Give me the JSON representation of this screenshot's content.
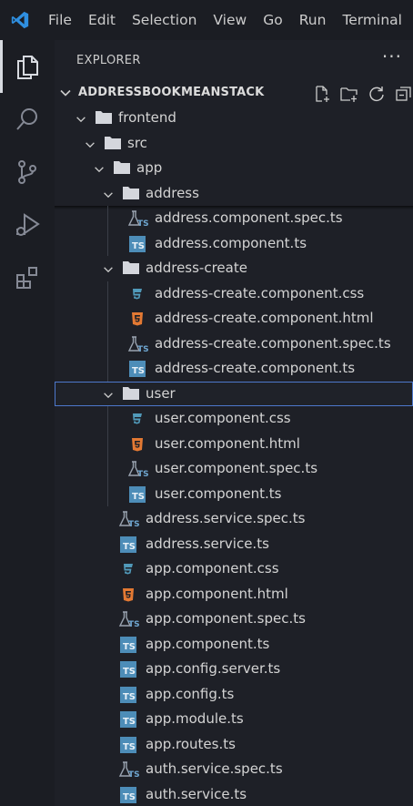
{
  "menu": [
    "File",
    "Edit",
    "Selection",
    "View",
    "Go",
    "Run",
    "Terminal"
  ],
  "activity_bar": [
    {
      "name": "explorer-icon",
      "active": true
    },
    {
      "name": "search-icon",
      "active": false
    },
    {
      "name": "source-control-icon",
      "active": false
    },
    {
      "name": "run-debug-icon",
      "active": false
    },
    {
      "name": "extensions-icon",
      "active": false
    }
  ],
  "explorer": {
    "title": "EXPLORER",
    "more": "···",
    "section_title": "ADDRESSBOOKMEANSTACK",
    "actions": [
      "new-file-icon",
      "new-folder-icon",
      "refresh-icon",
      "collapse-all-icon"
    ]
  },
  "tree": [
    {
      "label": "frontend",
      "type": "folder",
      "depth": 0
    },
    {
      "label": "src",
      "type": "folder",
      "depth": 1
    },
    {
      "label": "app",
      "type": "folder",
      "depth": 2
    },
    {
      "label": "address",
      "type": "folder",
      "depth": 3,
      "sticky": true
    },
    {
      "label": "address.component.spec.ts",
      "type": "spec",
      "depth": 4
    },
    {
      "label": "address.component.ts",
      "type": "ts",
      "depth": 4
    },
    {
      "label": "address-create",
      "type": "folder",
      "depth": 3
    },
    {
      "label": "address-create.component.css",
      "type": "css",
      "depth": 4
    },
    {
      "label": "address-create.component.html",
      "type": "html",
      "depth": 4
    },
    {
      "label": "address-create.component.spec.ts",
      "type": "spec",
      "depth": 4
    },
    {
      "label": "address-create.component.ts",
      "type": "ts",
      "depth": 4
    },
    {
      "label": "user",
      "type": "folder",
      "depth": 3,
      "selected": true
    },
    {
      "label": "user.component.css",
      "type": "css",
      "depth": 4
    },
    {
      "label": "user.component.html",
      "type": "html",
      "depth": 4
    },
    {
      "label": "user.component.spec.ts",
      "type": "spec",
      "depth": 4
    },
    {
      "label": "user.component.ts",
      "type": "ts",
      "depth": 4
    },
    {
      "label": "address.service.spec.ts",
      "type": "spec",
      "depth": 3
    },
    {
      "label": "address.service.ts",
      "type": "ts",
      "depth": 3
    },
    {
      "label": "app.component.css",
      "type": "css",
      "depth": 3
    },
    {
      "label": "app.component.html",
      "type": "html",
      "depth": 3
    },
    {
      "label": "app.component.spec.ts",
      "type": "spec",
      "depth": 3
    },
    {
      "label": "app.component.ts",
      "type": "ts",
      "depth": 3
    },
    {
      "label": "app.config.server.ts",
      "type": "ts",
      "depth": 3
    },
    {
      "label": "app.config.ts",
      "type": "ts",
      "depth": 3
    },
    {
      "label": "app.module.ts",
      "type": "ts",
      "depth": 3
    },
    {
      "label": "app.routes.ts",
      "type": "ts",
      "depth": 3
    },
    {
      "label": "auth.service.spec.ts",
      "type": "spec",
      "depth": 3
    },
    {
      "label": "auth.service.ts",
      "type": "ts",
      "depth": 3
    }
  ],
  "colors": {
    "background": "#1e2027",
    "activity_bar": "#1b1d23",
    "text": "#d4d4d4",
    "ts_icon": "#4d8db8",
    "html_icon": "#e37933",
    "css_icon": "#519aba",
    "selection_border": "#4d78cc"
  }
}
